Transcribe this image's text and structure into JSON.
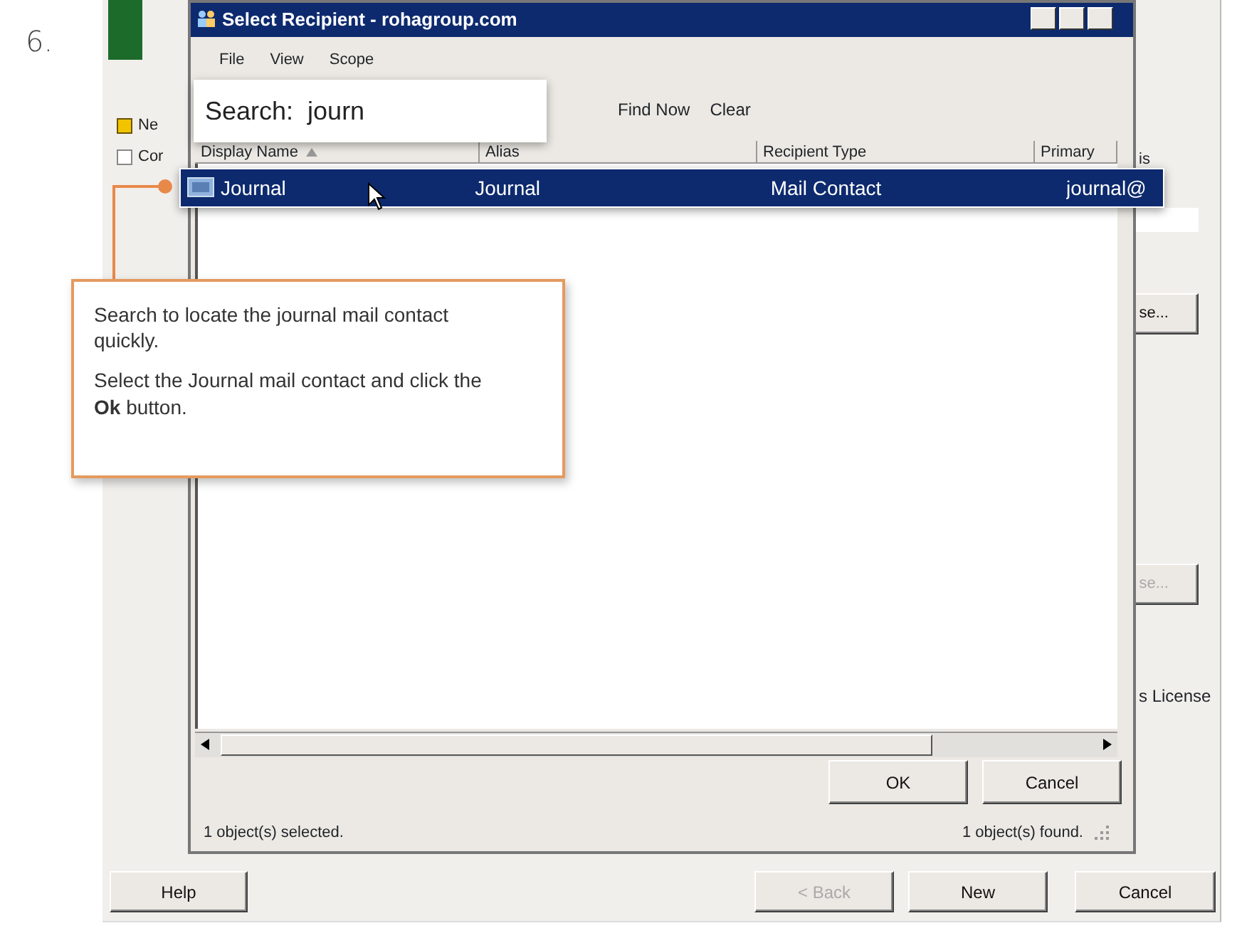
{
  "step": "6.",
  "wizard": {
    "options": [
      {
        "label": "Ne",
        "checked": true
      },
      {
        "label": "Cor",
        "checked": false
      }
    ],
    "side_text": "is",
    "side_buttons": [
      {
        "label": "se...",
        "disabled": false
      },
      {
        "label": "se...",
        "disabled": true
      }
    ],
    "license_text": "s License",
    "footer_buttons": [
      {
        "label": "Help",
        "disabled": false
      },
      {
        "label": "< Back",
        "disabled": true
      },
      {
        "label": "New",
        "disabled": false
      },
      {
        "label": "Cancel",
        "disabled": false
      }
    ]
  },
  "dialog": {
    "title": "Select Recipient - rohagroup.com",
    "menu": [
      "File",
      "View",
      "Scope"
    ],
    "search": {
      "label": "Search:",
      "value": "journ"
    },
    "search_buttons": [
      "Find Now",
      "Clear"
    ],
    "columns": [
      {
        "label": "Display Name",
        "sorted": true
      },
      {
        "label": "Alias",
        "sorted": false
      },
      {
        "label": "Recipient Type",
        "sorted": false
      },
      {
        "label": "Primary",
        "sorted": false
      }
    ],
    "rows": [
      {
        "cells": [
          "Journal",
          "Journal",
          "Mail Contact",
          "journal@"
        ],
        "selected": true
      }
    ],
    "buttons": [
      "OK",
      "Cancel"
    ],
    "status_left": "1 object(s) selected.",
    "status_right": "1 object(s) found."
  },
  "callout": {
    "paragraphs": [
      "Search to locate the journal mail contact quickly.",
      "Select the Journal mail contact and click the **Ok** button."
    ]
  }
}
